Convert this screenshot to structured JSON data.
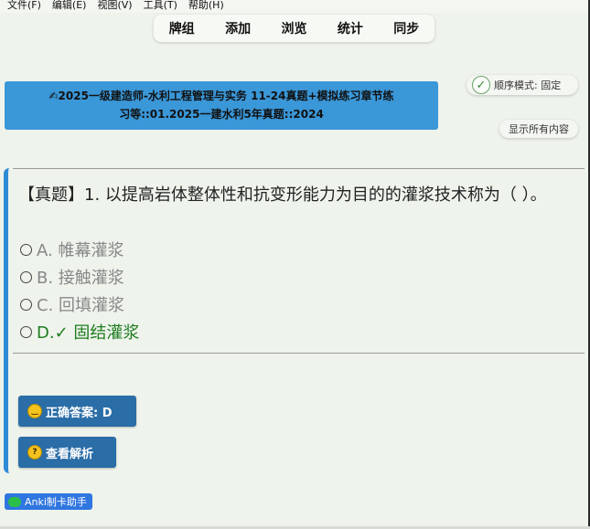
{
  "menu": {
    "items": [
      "文件(F)",
      "编辑(E)",
      "视图(V)",
      "工具(T)",
      "帮助(H)"
    ]
  },
  "toolbar": {
    "items": [
      "牌组",
      "添加",
      "浏览",
      "统计",
      "同步"
    ]
  },
  "order_mode": {
    "label": "顺序模式: 固定"
  },
  "show_all": {
    "label": "显示所有内容"
  },
  "title": {
    "line1": "2025一级建造师-水利工程管理与实务 11-24真题+模拟练习章节练",
    "line2": "习等::01.2025一建水利5年真题::2024"
  },
  "question": {
    "text": "【真题】1. 以提高岩体整体性和抗变形能力为目的的灌浆技术称为（ ）。"
  },
  "options": [
    {
      "label": "A. 帷幕灌浆",
      "correct": false
    },
    {
      "label": "B. 接触灌浆",
      "correct": false
    },
    {
      "label": "C. 回填灌浆",
      "correct": false
    },
    {
      "label": "D.✓ 固结灌浆",
      "correct": true
    }
  ],
  "buttons": {
    "answer": "正确答案: D",
    "analysis": "查看解析"
  },
  "footer": {
    "badge": "Anki制卡助手"
  },
  "colors": {
    "banner": "#3a97d8",
    "button": "#2a6da7",
    "correct": "#1e7d1e",
    "card_border": "#2f8bd6"
  }
}
